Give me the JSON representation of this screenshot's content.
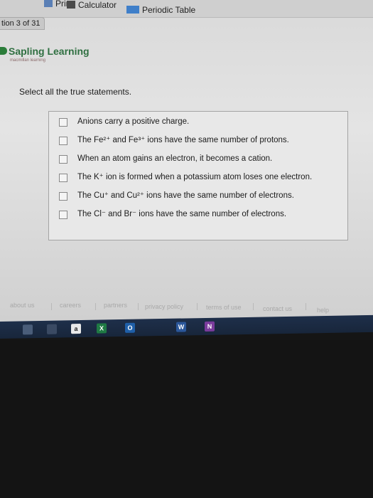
{
  "bookmarks": [
    {
      "label": "Print"
    },
    {
      "label": "Calculator"
    },
    {
      "label": "Periodic Table"
    }
  ],
  "tab": {
    "label": "tion 3 of 31"
  },
  "brand": {
    "name": "Sapling Learning",
    "subtitle": "macmillan learning"
  },
  "question": {
    "prompt": "Select all the true statements.",
    "options": [
      {
        "text": "Anions carry a positive charge.",
        "checked": false
      },
      {
        "text": "The Fe²⁺ and Fe³⁺ ions have the same number of protons.",
        "checked": false
      },
      {
        "text": "When an atom gains an electron, it becomes a cation.",
        "checked": false
      },
      {
        "text": "The K⁺ ion is formed when a potassium atom loses one electron.",
        "checked": false
      },
      {
        "text": "The Cu⁺ and Cu²⁺ ions have the same number of electrons.",
        "checked": false
      },
      {
        "text": "The Cl⁻ and Br⁻ ions have the same number of electrons.",
        "checked": false
      }
    ]
  },
  "footer": {
    "links": [
      "about us",
      "careers",
      "partners",
      "privacy policy",
      "terms of use",
      "contact us",
      "help"
    ]
  },
  "taskbar": {
    "icons": [
      "start-icon",
      "store-icon",
      "amazon-icon",
      "excel-icon",
      "outlook-icon",
      "word-icon",
      "onenote-icon"
    ],
    "labels": {
      "amazon": "a",
      "excel": "X",
      "outlook": "O",
      "word": "W",
      "onenote": "N"
    }
  },
  "colors": {
    "brand_green": "#2f6f41",
    "taskbar": "#1e2f4a"
  }
}
